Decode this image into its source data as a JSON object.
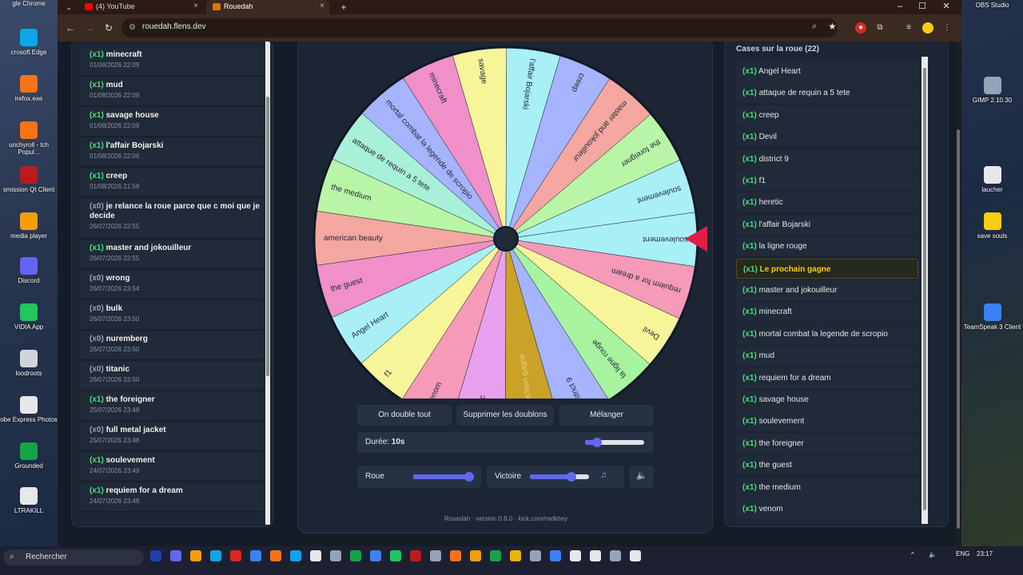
{
  "desktop": {
    "left_icons": [
      {
        "label": "gle Chrome",
        "color": "#3b82f6"
      },
      {
        "label": "crosoft Edge",
        "color": "#0ea5e9"
      },
      {
        "label": "irefox.exe",
        "color": "#f97316"
      },
      {
        "label": "unchyroll - tch Popul...",
        "color": "#f97316"
      },
      {
        "label": "smission Qt Client",
        "color": "#b91c1c"
      },
      {
        "label": "media player",
        "color": "#f59e0b"
      },
      {
        "label": "Discord",
        "color": "#6366f1"
      },
      {
        "label": "VIDIA App",
        "color": "#22c55e"
      },
      {
        "label": "loodroots",
        "color": "#d1d5db"
      },
      {
        "label": "obe Express Photos",
        "color": "#e5e7eb"
      },
      {
        "label": "Grounded",
        "color": "#16a34a"
      },
      {
        "label": "LTRAKILL",
        "color": "#e5e7eb"
      }
    ],
    "right_icons": [
      {
        "label": "OBS Studio",
        "color": "#1f2937"
      },
      {
        "label": "GIMP 2.10.30",
        "color": "#94a3b8"
      },
      {
        "label": "laucher",
        "color": "#e5e7eb"
      },
      {
        "label": "save souls",
        "color": "#facc15"
      },
      {
        "label": "TeamSpeak 3 Client",
        "color": "#3b82f6"
      }
    ]
  },
  "browser": {
    "app_label": "gle Chrome",
    "tabs": [
      {
        "title": "(4) YouTube",
        "fav": "#ff0000"
      },
      {
        "title": "Rouedah",
        "fav": "#d97706"
      }
    ],
    "url": "rouedah.flens.dev"
  },
  "history": {
    "items": [
      {
        "count": "(x1)",
        "name": "minecraft",
        "date": "01/08/2026 22:09"
      },
      {
        "count": "(x1)",
        "name": "mud",
        "date": "01/08/2026 22:09"
      },
      {
        "count": "(x1)",
        "name": "savage house",
        "date": "01/08/2026 22:09"
      },
      {
        "count": "(x1)",
        "name": "l'affair Bojarski",
        "date": "01/08/2026 22:06"
      },
      {
        "count": "(x1)",
        "name": "creep",
        "date": "01/08/2026 21:59"
      },
      {
        "count": "(x0)",
        "name": "je relance la roue parce que c moi que je decide",
        "date": "26/07/2026 23:55"
      },
      {
        "count": "(x1)",
        "name": "master and jokouilleur",
        "date": "26/07/2026 23:55"
      },
      {
        "count": "(x0)",
        "name": "wrong",
        "date": "26/07/2026 23:54"
      },
      {
        "count": "(x0)",
        "name": "bulk",
        "date": "26/07/2026 23:50"
      },
      {
        "count": "(x0)",
        "name": "nuremberg",
        "date": "26/07/2026 23:50"
      },
      {
        "count": "(x0)",
        "name": "titanic",
        "date": "26/07/2026 23:50"
      },
      {
        "count": "(x1)",
        "name": "the foreigner",
        "date": "25/07/2026 23:48"
      },
      {
        "count": "(x0)",
        "name": "full metal jacket",
        "date": "25/07/2026 23:48"
      },
      {
        "count": "(x1)",
        "name": "soulevement",
        "date": "24/07/2026 23:49"
      },
      {
        "count": "(x1)",
        "name": "requiem for a dream",
        "date": "24/07/2026 23:48"
      }
    ]
  },
  "wheel": {
    "segments": [
      {
        "label": "soulevement",
        "color": "#a8f0f5"
      },
      {
        "label": "requiem for a dream",
        "color": "#f59ab8"
      },
      {
        "label": "Devil",
        "color": "#f6f59a"
      },
      {
        "label": "la ligne rouge",
        "color": "#a7f3a0"
      },
      {
        "label": "district 9",
        "color": "#a5b4fc"
      },
      {
        "label": "Le prochain gagne",
        "color": "#c9a227"
      },
      {
        "label": "heretic",
        "color": "#e8a0ee"
      },
      {
        "label": "venom",
        "color": "#f59ab8"
      },
      {
        "label": "f1",
        "color": "#f6f59a"
      },
      {
        "label": "Angel Heart",
        "color": "#a8f0f5"
      },
      {
        "label": "the guest",
        "color": "#f08fc8"
      },
      {
        "label": "american beauty",
        "color": "#f4a6a0"
      },
      {
        "label": "the medium",
        "color": "#b9f5a6"
      },
      {
        "label": "attaque de requin a 5 tete",
        "color": "#a8f0d8"
      },
      {
        "label": "mortal combat la legende de scropio",
        "color": "#a5b4fc"
      },
      {
        "label": "minecraft",
        "color": "#f08fc8"
      },
      {
        "label": "savage",
        "color": "#f6f59a"
      },
      {
        "label": "l'affair Bojarski",
        "color": "#a8f0f5"
      },
      {
        "label": "creep",
        "color": "#a5b4fc"
      },
      {
        "label": "master and jokouilleur",
        "color": "#f4a6a0"
      },
      {
        "label": "the foreigner",
        "color": "#b9f5a6"
      },
      {
        "label": "soulevement",
        "color": "#a8f0f5"
      }
    ],
    "pointer_color": "#e11d48"
  },
  "controls": {
    "double_label": "On double tout",
    "dedupe_label": "Supprimer les doublons",
    "shuffle_label": "Mélanger",
    "duration_label": "Durée:",
    "duration_value": "10s",
    "duration_level": 0.2,
    "roue_label": "Roue",
    "roue_level": 0.95,
    "victoire_label": "Victoire",
    "victoire_level": 0.7
  },
  "footer": "Rouedah · version 0.8.0 · kick.com/redkhey",
  "cases": {
    "title": "Cases sur la roue (22)",
    "items": [
      {
        "count": "(x1)",
        "name": "Angel Heart"
      },
      {
        "count": "(x1)",
        "name": "attaque de requin a 5 tete"
      },
      {
        "count": "(x1)",
        "name": "creep"
      },
      {
        "count": "(x1)",
        "name": "Devil"
      },
      {
        "count": "(x1)",
        "name": "district 9"
      },
      {
        "count": "(x1)",
        "name": "f1"
      },
      {
        "count": "(x1)",
        "name": "heretic"
      },
      {
        "count": "(x1)",
        "name": "l'affair Bojarski"
      },
      {
        "count": "(x1)",
        "name": "la ligne rouge"
      },
      {
        "count": "(x1)",
        "name": "Le prochain gagne",
        "highlight": true
      },
      {
        "count": "(x1)",
        "name": "master and jokouilleur"
      },
      {
        "count": "(x1)",
        "name": "minecraft"
      },
      {
        "count": "(x1)",
        "name": "mortal combat la legende de scropio"
      },
      {
        "count": "(x1)",
        "name": "mud"
      },
      {
        "count": "(x1)",
        "name": "requiem for a dream"
      },
      {
        "count": "(x1)",
        "name": "savage house"
      },
      {
        "count": "(x1)",
        "name": "soulevement"
      },
      {
        "count": "(x1)",
        "name": "the foreigner"
      },
      {
        "count": "(x1)",
        "name": "the guest"
      },
      {
        "count": "(x1)",
        "name": "the medium"
      },
      {
        "count": "(x1)",
        "name": "venom"
      }
    ]
  },
  "taskbar": {
    "search_label": "Rechercher",
    "lang": "ENG",
    "time": "23:17",
    "icons": [
      "#1e40af",
      "#6366f1",
      "#f59e0b",
      "#0ea5e9",
      "#dc2626",
      "#3b82f6",
      "#f97316",
      "#0ea5e9",
      "#e5e7eb",
      "#94a3b8",
      "#16a34a",
      "#3b82f6",
      "#22c55e",
      "#b91c1c",
      "#94a3b8",
      "#f97316",
      "#f59e0b",
      "#16a34a",
      "#eab308",
      "#94a3b8",
      "#3b82f6",
      "#e5e7eb",
      "#e5e7eb",
      "#94a3b8",
      "#e5e7eb"
    ]
  }
}
